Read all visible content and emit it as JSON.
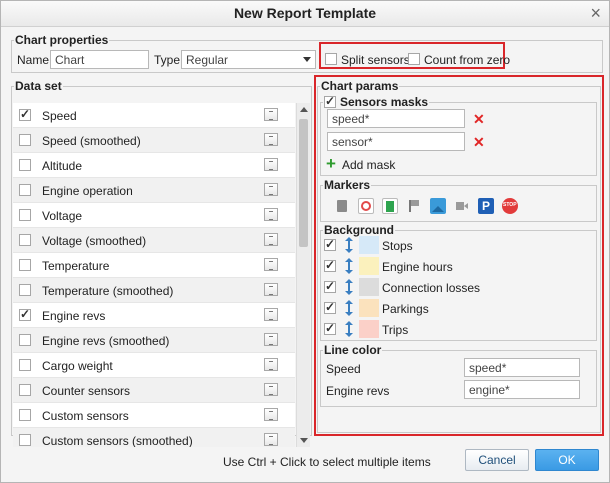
{
  "window": {
    "title": "New Report Template"
  },
  "chart_properties": {
    "legend": "Chart properties",
    "name_label": "Name:",
    "name_value": "Chart",
    "type_label": "Type:",
    "type_value": "Regular",
    "split_sensors_label": "Split sensors",
    "split_sensors_checked": false,
    "count_from_zero_label": "Count from zero",
    "count_from_zero_checked": false
  },
  "data_set": {
    "legend": "Data set",
    "items": [
      {
        "label": "Speed",
        "checked": true
      },
      {
        "label": "Speed (smoothed)",
        "checked": false
      },
      {
        "label": "Altitude",
        "checked": false
      },
      {
        "label": "Engine operation",
        "checked": false
      },
      {
        "label": "Voltage",
        "checked": false
      },
      {
        "label": "Voltage (smoothed)",
        "checked": false
      },
      {
        "label": "Temperature",
        "checked": false
      },
      {
        "label": "Temperature (smoothed)",
        "checked": false
      },
      {
        "label": "Engine revs",
        "checked": true
      },
      {
        "label": "Engine revs (smoothed)",
        "checked": false
      },
      {
        "label": "Cargo weight",
        "checked": false
      },
      {
        "label": "Counter sensors",
        "checked": false
      },
      {
        "label": "Custom sensors",
        "checked": false
      },
      {
        "label": "Custom sensors (smoothed)",
        "checked": false
      }
    ]
  },
  "chart_params": {
    "legend": "Chart params",
    "sensors_masks": {
      "legend": "Sensors masks",
      "checked": true,
      "masks": [
        "speed*",
        "sensor*"
      ],
      "add_label": "Add mask"
    },
    "markers": {
      "legend": "Markers",
      "icons": [
        {
          "name": "fuel-can-icon",
          "color": "#8a8a8a"
        },
        {
          "name": "speedometer-icon",
          "color": "#e24a4a"
        },
        {
          "name": "fuel-station-icon",
          "color": "#2ea44f"
        },
        {
          "name": "flag-icon",
          "color": "#9a9a9a"
        },
        {
          "name": "image-icon",
          "color": "#3a9ad9"
        },
        {
          "name": "video-icon",
          "color": "#9a9a9a"
        },
        {
          "name": "parking-icon",
          "color": "#1f5fb5"
        },
        {
          "name": "stop-icon",
          "color": "#e23b3b"
        }
      ]
    },
    "background": {
      "legend": "Background",
      "items": [
        {
          "label": "Stops",
          "checked": true,
          "color": "#d6e9f8"
        },
        {
          "label": "Engine hours",
          "checked": true,
          "color": "#fbf1bd"
        },
        {
          "label": "Connection losses",
          "checked": true,
          "color": "#dcdcdc"
        },
        {
          "label": "Parkings",
          "checked": true,
          "color": "#fbe2bd"
        },
        {
          "label": "Trips",
          "checked": true,
          "color": "#fbd0c8"
        }
      ]
    },
    "line_color": {
      "legend": "Line color",
      "rows": [
        {
          "label": "Speed",
          "value": "speed*"
        },
        {
          "label": "Engine revs",
          "value": "engine*"
        }
      ]
    }
  },
  "footer": {
    "hint": "Use Ctrl + Click to select multiple items",
    "cancel_label": "Cancel",
    "ok_label": "OK"
  }
}
